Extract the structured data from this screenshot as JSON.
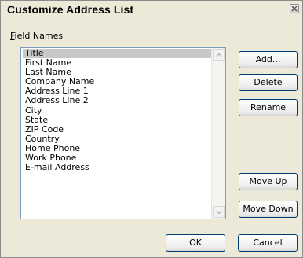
{
  "dialog": {
    "title": "Customize Address List"
  },
  "field_names_label": {
    "accel": "F",
    "rest": "ield Names"
  },
  "fields": [
    "Title",
    "First Name",
    "Last Name",
    "Company Name",
    "Address Line 1",
    "Address Line 2",
    "City",
    "State",
    "ZIP Code",
    "Country",
    "Home Phone",
    "Work Phone",
    "E-mail Address"
  ],
  "selected_field": "Title",
  "buttons": {
    "add": "Add...",
    "delete": "Delete",
    "rename": "Rename",
    "move_up": "Move Up",
    "move_down": "Move Down",
    "ok": "OK",
    "cancel": "Cancel"
  },
  "icons": {
    "close": "close-icon",
    "scroll_up": "chevron-up-icon",
    "scroll_down": "chevron-down-icon"
  },
  "colors": {
    "selection": "#c8c8c8",
    "button_border": "#003c74",
    "dialog_bg": "#ece9d8"
  }
}
